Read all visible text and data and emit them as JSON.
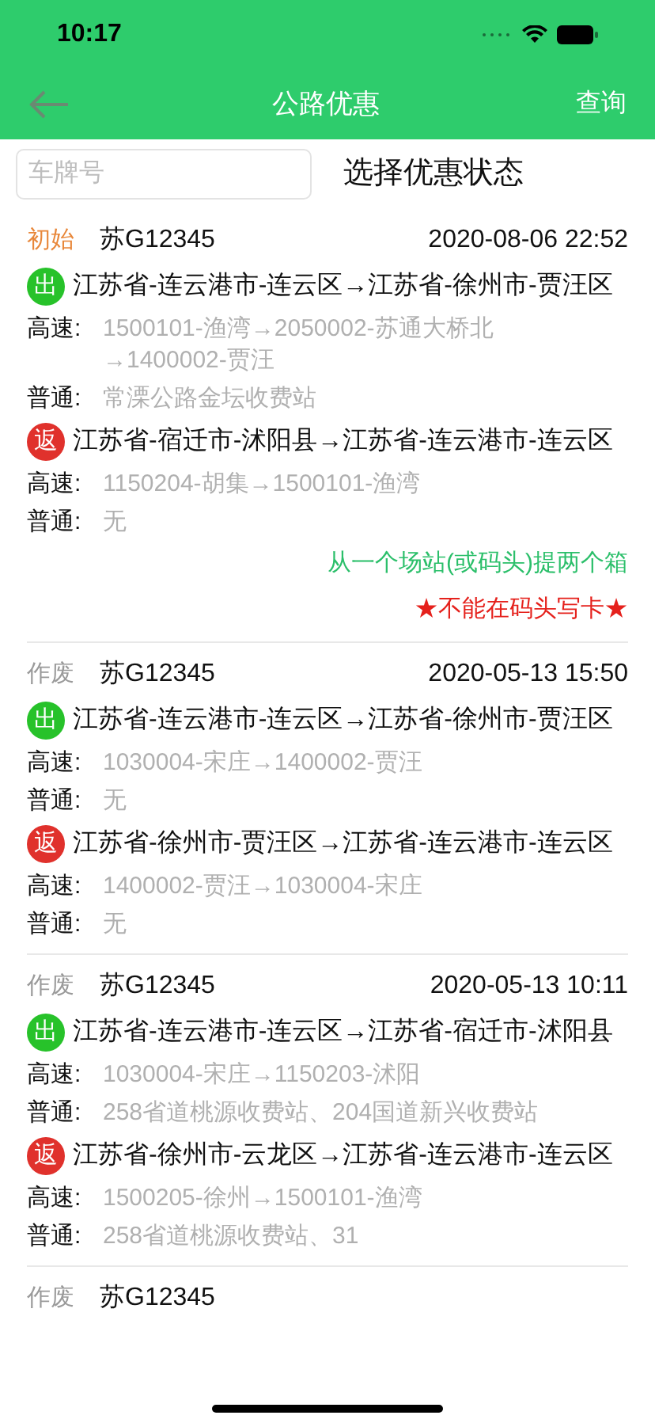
{
  "status_bar": {
    "time": "10:17"
  },
  "nav": {
    "title": "公路优惠",
    "action": "查询"
  },
  "filter": {
    "placeholder": "车牌号",
    "status_label": "选择优惠状态"
  },
  "records": [
    {
      "status": "初始",
      "kind": "initial",
      "plate": "苏G12345",
      "time": "2020-08-06 22:52",
      "trips": [
        {
          "kind": "out",
          "badge": "出",
          "route": "江苏省-连云港市-连云区→江苏省-徐州市-贾汪区",
          "lines": [
            {
              "label": "高速:",
              "value": "1500101-渔湾→2050002-苏通大桥北→1400002-贾汪"
            },
            {
              "label": "普通:",
              "value": "常溧公路金坛收费站"
            }
          ]
        },
        {
          "kind": "return",
          "badge": "返",
          "route": "江苏省-宿迁市-沭阳县→江苏省-连云港市-连云区",
          "lines": [
            {
              "label": "高速:",
              "value": "1150204-胡集→1500101-渔湾"
            },
            {
              "label": "普通:",
              "value": "无"
            }
          ]
        }
      ],
      "notes": [
        {
          "kind": "info",
          "text": "从一个场站(或码头)提两个箱"
        },
        {
          "kind": "warning",
          "text": "★不能在码头写卡★"
        }
      ]
    },
    {
      "status": "作废",
      "kind": "void",
      "plate": "苏G12345",
      "time": "2020-05-13 15:50",
      "trips": [
        {
          "kind": "out",
          "badge": "出",
          "route": "江苏省-连云港市-连云区→江苏省-徐州市-贾汪区",
          "lines": [
            {
              "label": "高速:",
              "value": "1030004-宋庄→1400002-贾汪"
            },
            {
              "label": "普通:",
              "value": "无"
            }
          ]
        },
        {
          "kind": "return",
          "badge": "返",
          "route": "江苏省-徐州市-贾汪区→江苏省-连云港市-连云区",
          "lines": [
            {
              "label": "高速:",
              "value": "1400002-贾汪→1030004-宋庄"
            },
            {
              "label": "普通:",
              "value": "无"
            }
          ]
        }
      ]
    },
    {
      "status": "作废",
      "kind": "void",
      "plate": "苏G12345",
      "time": "2020-05-13 10:11",
      "trips": [
        {
          "kind": "out",
          "badge": "出",
          "route": "江苏省-连云港市-连云区→江苏省-宿迁市-沭阳县",
          "lines": [
            {
              "label": "高速:",
              "value": "1030004-宋庄→1150203-沭阳"
            },
            {
              "label": "普通:",
              "value": "258省道桃源收费站、204国道新兴收费站"
            }
          ]
        },
        {
          "kind": "return",
          "badge": "返",
          "route": "江苏省-徐州市-云龙区→江苏省-连云港市-连云区",
          "lines": [
            {
              "label": "高速:",
              "value": "1500205-徐州→1500101-渔湾"
            },
            {
              "label": "普通:",
              "value": "258省道桃源收费站、31"
            }
          ]
        }
      ]
    },
    {
      "status": "作废",
      "kind": "void",
      "plate": "苏G12345"
    }
  ]
}
